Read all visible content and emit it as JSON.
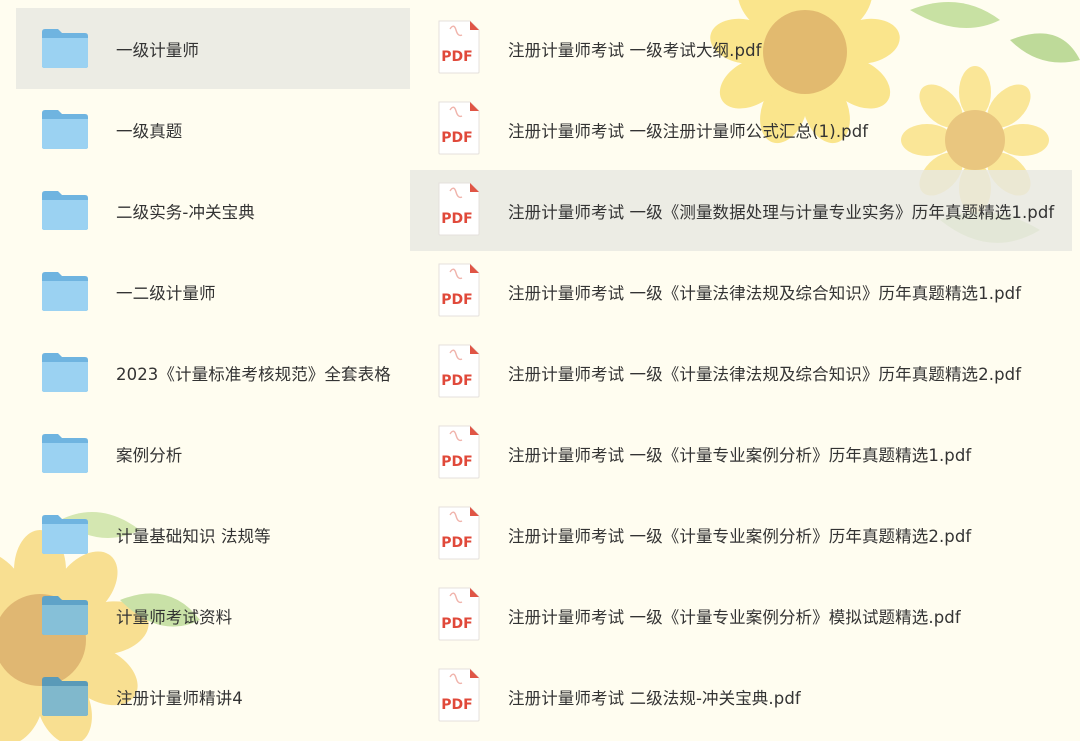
{
  "folders": [
    {
      "name": "一级计量师",
      "selected": true
    },
    {
      "name": "一级真题",
      "selected": false
    },
    {
      "name": "二级实务-冲关宝典",
      "selected": false
    },
    {
      "name": "一二级计量师",
      "selected": false
    },
    {
      "name": "2023《计量标准考核规范》全套表格",
      "selected": false
    },
    {
      "name": "案例分析",
      "selected": false
    },
    {
      "name": "计量基础知识 法规等",
      "selected": false
    },
    {
      "name": "计量师考试资料",
      "selected": false
    },
    {
      "name": "注册计量师精讲4",
      "selected": false
    }
  ],
  "files": [
    {
      "name": "注册计量师考试 一级考试大纲.pdf",
      "selected": false
    },
    {
      "name": "注册计量师考试 一级注册计量师公式汇总(1).pdf",
      "selected": false
    },
    {
      "name": "注册计量师考试 一级《测量数据处理与计量专业实务》历年真题精选1.pdf",
      "selected": true
    },
    {
      "name": "注册计量师考试 一级《计量法律法规及综合知识》历年真题精选1.pdf",
      "selected": false
    },
    {
      "name": "注册计量师考试 一级《计量法律法规及综合知识》历年真题精选2.pdf",
      "selected": false
    },
    {
      "name": "注册计量师考试 一级《计量专业案例分析》历年真题精选1.pdf",
      "selected": false
    },
    {
      "name": "注册计量师考试 一级《计量专业案例分析》历年真题精选2.pdf",
      "selected": false
    },
    {
      "name": "注册计量师考试 一级《计量专业案例分析》模拟试题精选.pdf",
      "selected": false
    },
    {
      "name": "注册计量师考试 二级法规-冲关宝典.pdf",
      "selected": false
    }
  ],
  "icons": {
    "folder": "folder-icon",
    "pdf": "pdf-file-icon"
  },
  "colors": {
    "folder": "#8cc8ec",
    "pdf_text": "#e0493a",
    "text": "#333333",
    "selected_bg": "#e8e8e0"
  },
  "pdf_badge": "PDF"
}
